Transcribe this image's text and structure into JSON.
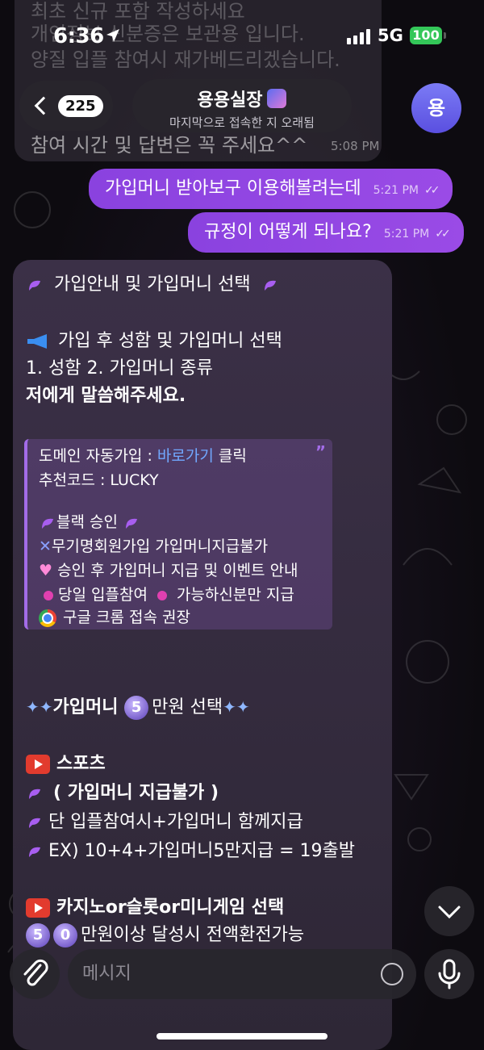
{
  "status_bar": {
    "time": "6:36",
    "network": "5G",
    "battery": "100"
  },
  "header": {
    "back_count": "225",
    "chat_name": "용용실장",
    "chat_status": "마지막으로 접속한 지 오래됨",
    "avatar_letter": "용"
  },
  "old_messages": {
    "lines": [
      "최초 신규 포함 작성하세요",
      "개인정보 신분증은 보관용 입니다.",
      "양질 입플 참여시 재가베드리겠습니다.",
      "참여 시간 및 답변은 꼭 주세요^^"
    ],
    "time": "5:08 PM"
  },
  "outgoing": [
    {
      "text": "가입머니 받아보구 이용해볼려는데",
      "time": "5:21 PM"
    },
    {
      "text": "규정이 어떻게 되나요?",
      "time": "5:21 PM"
    }
  ],
  "incoming": {
    "heading": "가입안내 및 가입머니 선택",
    "section1_title": "가입 후 성함 및 가입머니 선택",
    "section1_line2": "1. 성함  2. 가입머니 종류",
    "section1_line3": "저에게 말씀해주세요.",
    "quote": {
      "line1_prefix": "도메인 자동가입 : ",
      "line1_link": "바로가기",
      "line1_suffix": " 클릭",
      "line2": "추천코드 :  LUCKY",
      "line3": "블랙 승인",
      "line4": "무기명회원가입 가입머니지급불가",
      "line5": "승인 후 가입머니 지급 및 이벤트 안내",
      "line6a": "당일 입플참여",
      "line6b": "가능하신분만 지급",
      "line7": "구글 크롬 접속 권장",
      "quote_mark": "”"
    },
    "money_title_a": "가입머니",
    "money_badge": "5",
    "money_title_b": "만원 선택",
    "sports_title": "스포츠",
    "sports_line1": "( 가입머니 지급불가 )",
    "sports_line2": "단 입플참여시+가입머니 함께지급",
    "sports_line3": "EX) 10+4+가입머니5만지급 = 19출발",
    "casino_title": "카지노or슬롯or미니게임 선택",
    "casino_badge1": "5",
    "casino_badge2": "0",
    "casino_line1": "만원이상 달성시 전액환전가능"
  },
  "input": {
    "placeholder": "메시지"
  },
  "colors": {
    "accent": "#8a42df",
    "link": "#71a8ff",
    "battery": "#34c759"
  }
}
